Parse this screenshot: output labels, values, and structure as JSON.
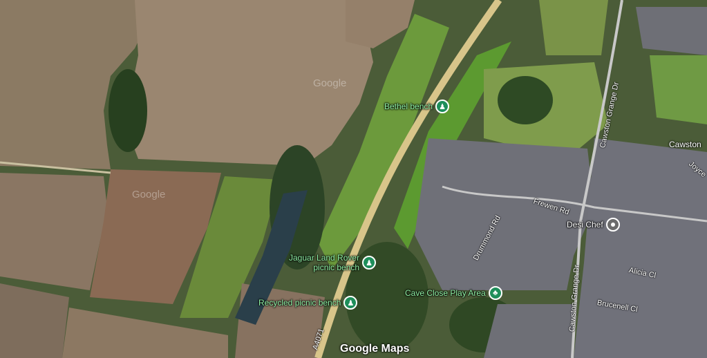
{
  "map": {
    "logo": "Google Maps",
    "watermarks": [
      "Google",
      "Google"
    ],
    "poi": [
      {
        "label": "Bethel bench",
        "icon": "hiker-icon",
        "color": "#1e8e5a"
      },
      {
        "label": "Jaguar Land Rover\npicnic bench",
        "icon": "hiker-icon",
        "color": "#1e8e5a"
      },
      {
        "label": "Recycled picnic bench",
        "icon": "hiker-icon",
        "color": "#1e8e5a"
      },
      {
        "label": "Cave Close Play Area",
        "icon": "tree-icon",
        "color": "#1e8e5a"
      },
      {
        "label": "Desi Chef",
        "icon": "place-dot-icon",
        "color": "#6b6b6b"
      }
    ],
    "roads": [
      "A4071",
      "Frewen Rd",
      "Drummond Rd",
      "Cawston Grange Dr",
      "Cawston Grange Dr",
      "Alicia Cl",
      "Brucenell Cl",
      "Joyce"
    ],
    "places": [
      "Cawston"
    ]
  }
}
